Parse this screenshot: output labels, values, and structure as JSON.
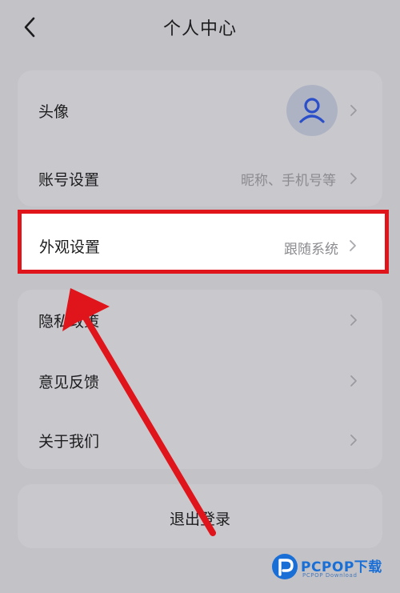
{
  "header": {
    "title": "个人中心"
  },
  "profile_card": {
    "avatar_row": {
      "label": "头像"
    },
    "account_row": {
      "label": "账号设置",
      "value": "昵称、手机号等"
    }
  },
  "appearance_row": {
    "label": "外观设置",
    "value": "跟随系统"
  },
  "settings_card": {
    "items": [
      {
        "label": "隐私政策"
      },
      {
        "label": "意见反馈"
      },
      {
        "label": "关于我们"
      }
    ]
  },
  "logout": {
    "label": "退出登录"
  },
  "watermark": {
    "brand": "PCPOP下载",
    "sub": "PCPOP Download"
  },
  "colors": {
    "highlight_border": "#e0141b",
    "arrow": "#e0141b",
    "brand_blue": "#1a6fd6",
    "avatar_icon": "#2b4fc9"
  },
  "icons": [
    "back-arrow-icon",
    "chevron-right-icon",
    "user-avatar-icon",
    "annotation-arrow-icon",
    "pcpop-logo-icon"
  ]
}
